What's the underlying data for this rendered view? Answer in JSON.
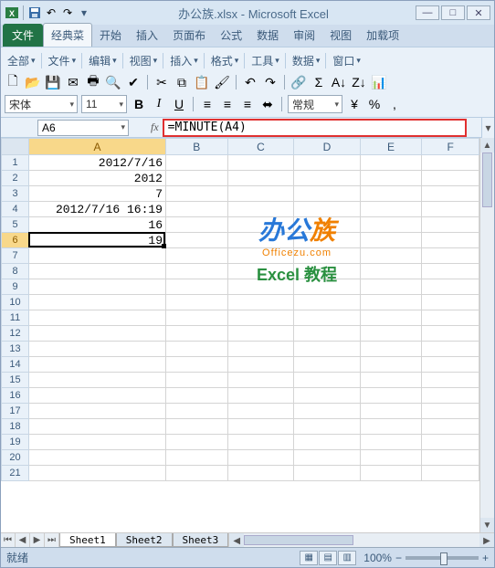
{
  "title": "办公族.xlsx - Microsoft Excel",
  "tabs": {
    "file": "文件",
    "classic": "经典菜",
    "home": "开始",
    "insert": "插入",
    "layout": "页面布",
    "formula": "公式",
    "data": "数据",
    "review": "审阅",
    "view": "视图",
    "addin": "加载项"
  },
  "menus": {
    "all": "全部",
    "file": "文件",
    "edit": "编辑",
    "view": "视图",
    "insert": "插入",
    "format": "格式",
    "tools": "工具",
    "data": "数据",
    "window": "窗口"
  },
  "format": {
    "font": "宋体",
    "size": "11",
    "style_label": "常规"
  },
  "namebox": "A6",
  "formula": "=MINUTE(A4)",
  "cols": [
    "A",
    "B",
    "C",
    "D",
    "E",
    "F"
  ],
  "rows_count": 21,
  "cells": {
    "A1": "2012/7/16",
    "A2": "2012",
    "A3": "7",
    "A4": "2012/7/16 16:19",
    "A5": "16",
    "A6": "19"
  },
  "active": {
    "row": 6,
    "col": "A"
  },
  "sheets": [
    "Sheet1",
    "Sheet2",
    "Sheet3"
  ],
  "status": {
    "ready": "就绪",
    "zoom": "100%"
  },
  "watermark": {
    "brand_cn1": "办公",
    "brand_cn2": "族",
    "domain": "Officezu.com",
    "sub": "Excel 教程"
  }
}
